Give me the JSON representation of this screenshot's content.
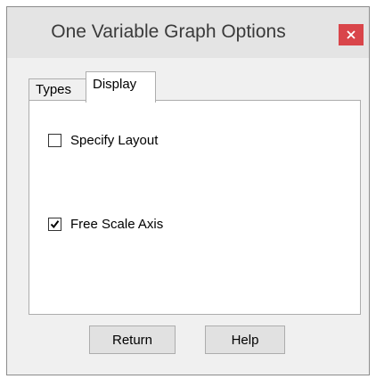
{
  "window": {
    "title": "One Variable Graph Options",
    "close_icon": "close-icon"
  },
  "tabs": [
    {
      "label": "Types",
      "active": false
    },
    {
      "label": "Display",
      "active": true
    }
  ],
  "display_panel": {
    "options": [
      {
        "label": "Specify Layout",
        "checked": false
      },
      {
        "label": "Free Scale Axis",
        "checked": true
      }
    ]
  },
  "buttons": {
    "return_label": "Return",
    "help_label": "Help"
  },
  "colors": {
    "close_button": "#d9454a",
    "window_background": "#f0f0f0",
    "panel_background": "#ffffff"
  }
}
